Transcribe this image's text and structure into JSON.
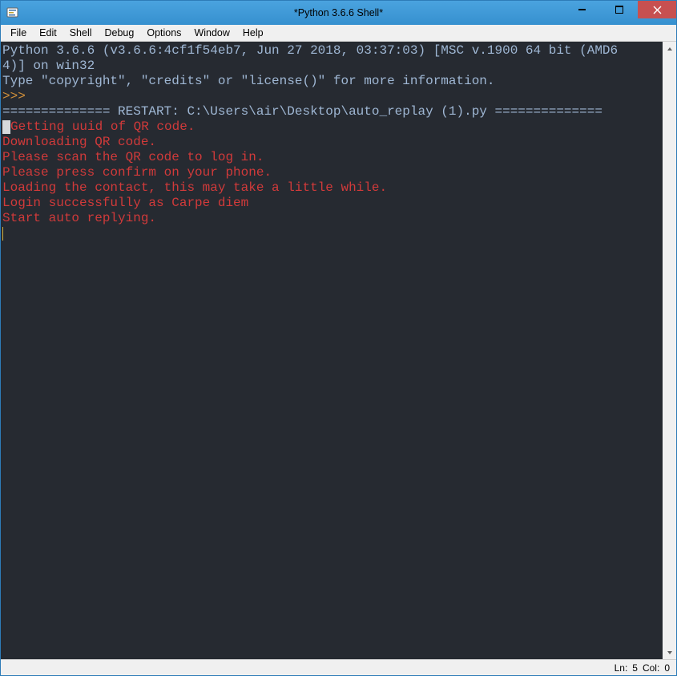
{
  "window": {
    "title": "*Python 3.6.6 Shell*"
  },
  "menu": {
    "items": [
      "File",
      "Edit",
      "Shell",
      "Debug",
      "Options",
      "Window",
      "Help"
    ]
  },
  "console": {
    "header_line1": "Python 3.6.6 (v3.6.6:4cf1f54eb7, Jun 27 2018, 03:37:03) [MSC v.1900 64 bit (AMD6",
    "header_line2": "4)] on win32",
    "header_line3": "Type \"copyright\", \"credits\" or \"license()\" for more information.",
    "prompt": ">>> ",
    "restart_line": "============== RESTART: C:\\Users\\air\\Desktop\\auto_replay (1).py ==============",
    "out1": "Getting uuid of QR code.",
    "out2": "Downloading QR code.",
    "out3": "Please scan the QR code to log in.",
    "out4": "Please press confirm on your phone.",
    "out5": "Loading the contact, this may take a little while.",
    "out6": "Login successfully as Carpe diem",
    "out7": "Start auto replying."
  },
  "status": {
    "ln_label": "Ln:",
    "ln_value": "5",
    "col_label": "Col:",
    "col_value": "0"
  },
  "colors": {
    "titlebar": "#3690cf",
    "console_bg": "#262a31",
    "text_blue": "#9fb7d4",
    "text_orange": "#d08f3a",
    "text_red": "#d13a3a",
    "close_btn": "#c75050"
  }
}
